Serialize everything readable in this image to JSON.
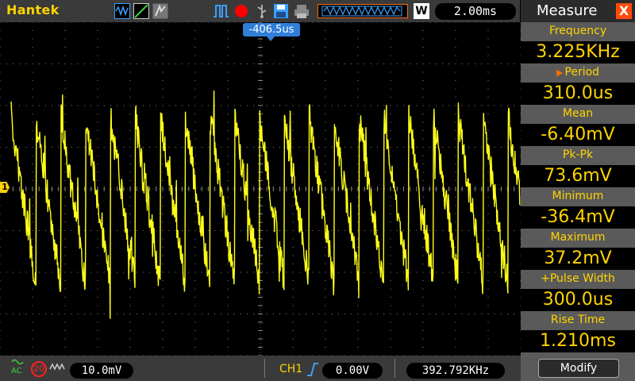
{
  "topbar": {
    "brand": "Hantek",
    "timebase": "2.00ms",
    "mode_letter": "W"
  },
  "scope": {
    "trigger_position_label": "-406.5us",
    "channel_marker": "1",
    "trace_color": "#ffff1a",
    "grid_color": "#8a8a8a"
  },
  "bottombar": {
    "coupling": "AC",
    "bandwidth_limit": "20",
    "volts_per_div": "10.0mV",
    "trigger_channel": "CH1",
    "trigger_level": "0.00V",
    "trigger_frequency": "392.792KHz"
  },
  "measure": {
    "title": "Measure",
    "close_label": "X",
    "items": [
      {
        "label": "Frequency",
        "value": "3.225KHz"
      },
      {
        "label": "Period",
        "value": "310.0us"
      },
      {
        "label": "Mean",
        "value": "-6.40mV"
      },
      {
        "label": "Pk-Pk",
        "value": "73.6mV"
      },
      {
        "label": "Minimum",
        "value": "-36.4mV"
      },
      {
        "label": "Maximum",
        "value": "37.2mV"
      },
      {
        "label": "+Pulse Width",
        "value": "300.0us"
      },
      {
        "label": "Rise Time",
        "value": "1.210ms"
      }
    ],
    "modify_label": "Modify"
  },
  "colors": {
    "accent": "#ffd400",
    "trigger_marker": "#2f7fd9",
    "close": "#ff4a0a",
    "record": "#ff0000"
  }
}
